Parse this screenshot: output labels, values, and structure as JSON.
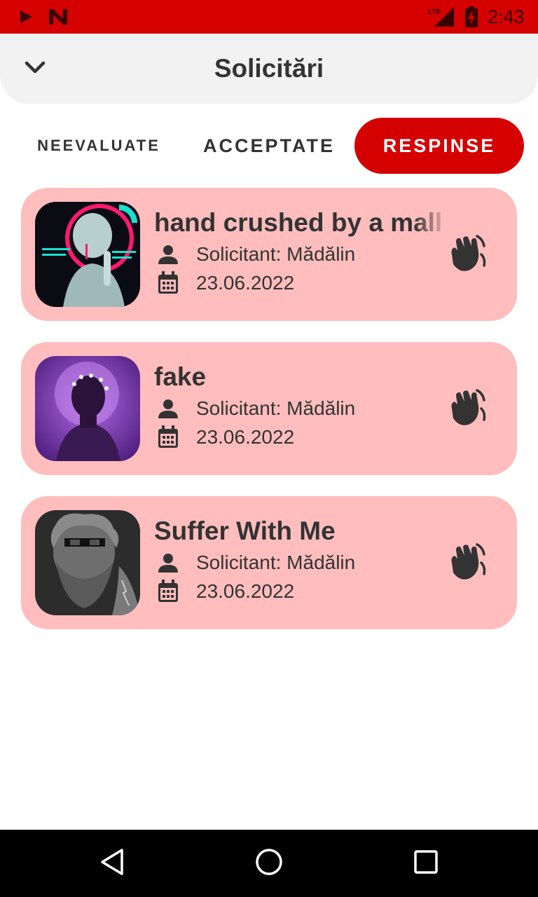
{
  "status_bar": {
    "time": "2:43",
    "icons": [
      "play-icon",
      "n-app-icon",
      "lte-signal-icon",
      "battery-charging-icon"
    ],
    "network_label": "LTE"
  },
  "header": {
    "title": "Solicitări",
    "back_icon": "chevron-down-icon"
  },
  "tabs": [
    {
      "label": "NEEVALUATE",
      "active": false
    },
    {
      "label": "ACCEPTATE",
      "active": false
    },
    {
      "label": "RESPINSE",
      "active": true
    }
  ],
  "requests": [
    {
      "title": "hand crushed by a mall",
      "requester": "Solicitant: Mădălin",
      "date": "23.06.2022",
      "thumbnail": "statue-neon-artwork",
      "action_icon": "wave-hand-icon"
    },
    {
      "title": "fake",
      "requester": "Solicitant: Mădălin",
      "date": "23.06.2022",
      "thumbnail": "purple-halo-artwork",
      "action_icon": "wave-hand-icon"
    },
    {
      "title": "Suffer With Me",
      "requester": "Solicitant: Mădălin",
      "date": "23.06.2022",
      "thumbnail": "bearded-statue-artwork",
      "action_icon": "wave-hand-icon"
    }
  ],
  "colors": {
    "accent": "#d50000",
    "card_background": "#ffbdbd",
    "header_background": "#f2f2f2",
    "text": "#333333"
  },
  "nav": {
    "icons": [
      "back-triangle-icon",
      "home-circle-icon",
      "recents-square-icon"
    ]
  }
}
